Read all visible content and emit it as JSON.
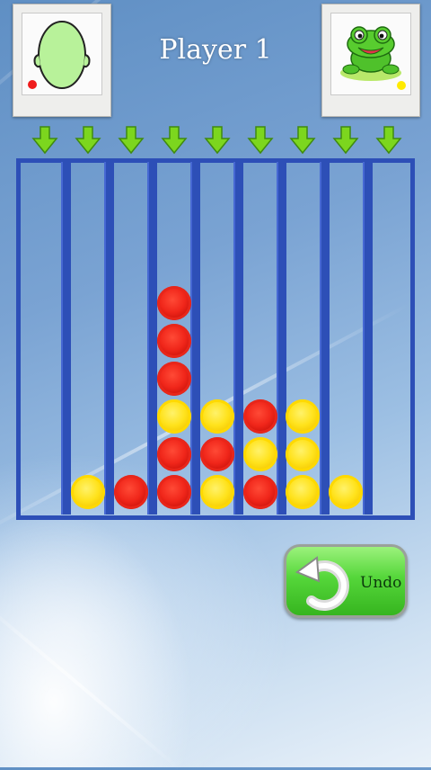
{
  "header": {
    "title": "Player 1"
  },
  "player1": {
    "avatar": "face-outline-icon",
    "chip_color": "red"
  },
  "player2": {
    "avatar": "frog-icon",
    "chip_color": "yellow"
  },
  "board": {
    "columns": 9,
    "rows": 9,
    "discs": [
      [
        "",
        "",
        "",
        "",
        "",
        "",
        "",
        "",
        ""
      ],
      [
        "",
        "",
        "",
        "",
        "",
        "",
        "",
        "",
        ""
      ],
      [
        "",
        "",
        "",
        "",
        "",
        "",
        "",
        "",
        ""
      ],
      [
        "",
        "",
        "",
        "red",
        "",
        "",
        "",
        "",
        ""
      ],
      [
        "",
        "",
        "",
        "red",
        "",
        "",
        "",
        "",
        ""
      ],
      [
        "",
        "",
        "",
        "red",
        "",
        "",
        "",
        "",
        ""
      ],
      [
        "",
        "",
        "",
        "yellow",
        "yellow",
        "red",
        "yellow",
        "",
        ""
      ],
      [
        "",
        "",
        "",
        "red",
        "red",
        "yellow",
        "yellow",
        "",
        ""
      ],
      [
        "",
        "yellow",
        "red",
        "red",
        "yellow",
        "red",
        "yellow",
        "yellow",
        ""
      ]
    ]
  },
  "colors": {
    "frame": "#2d4fb7",
    "arrow": "#7cd61e",
    "red": "#f0261a",
    "yellow": "#ffe21b",
    "button": "#55d63a"
  },
  "controls": {
    "undo_label": "Undo",
    "undo_icon": "undo-arrow-icon"
  }
}
